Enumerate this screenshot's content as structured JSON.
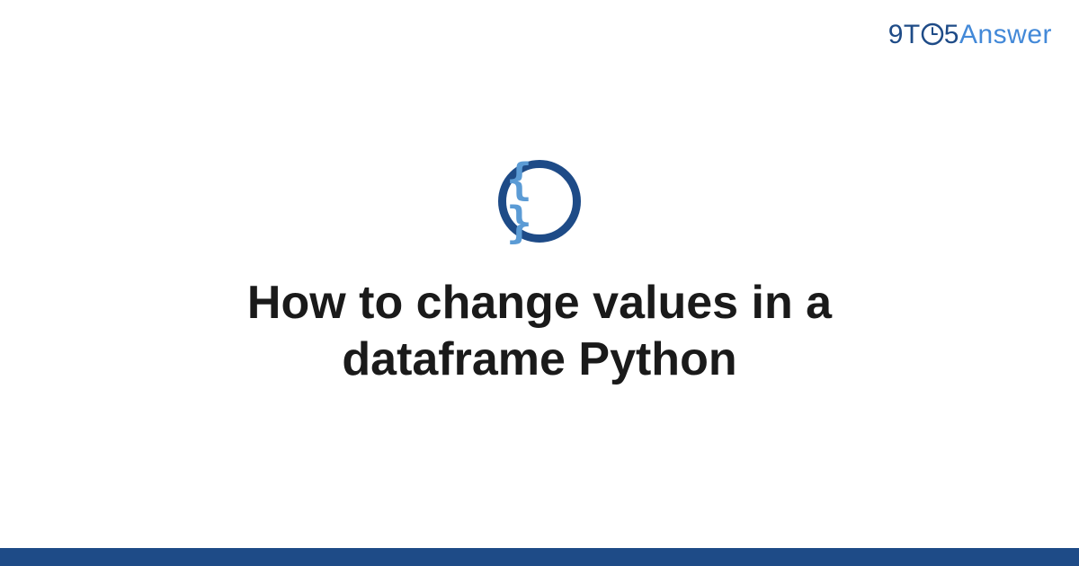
{
  "brand": {
    "part1": "9T",
    "part2": "5",
    "part3": "Answer"
  },
  "icon": {
    "symbol": "{ }"
  },
  "heading": "How to change values in a dataframe Python",
  "colors": {
    "dark_blue": "#1e4b87",
    "light_blue": "#5b9bd5",
    "brand_blue": "#4389d8"
  }
}
